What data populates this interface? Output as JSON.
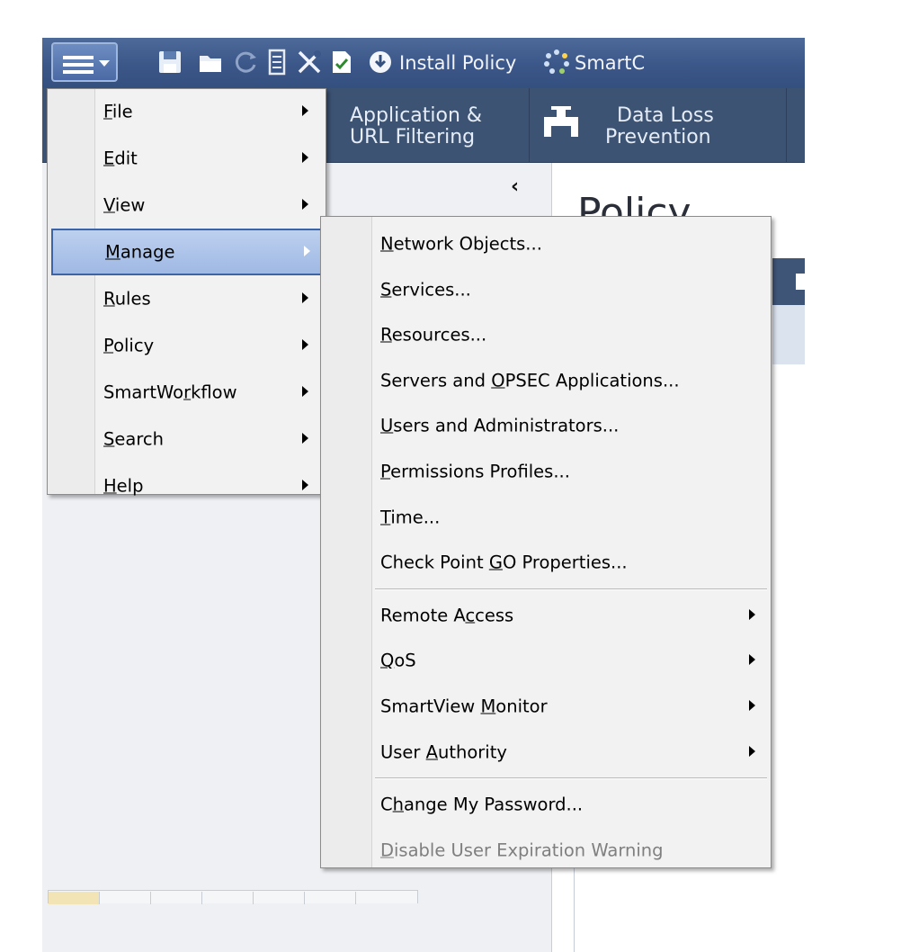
{
  "toolbar": {
    "install_policy_label": "Install Policy",
    "smartc_label": "SmartC",
    "icons": [
      "app-menu-icon",
      "save-icon",
      "open-folder-icon",
      "refresh-icon",
      "server-icon",
      "tools-icon",
      "verify-icon",
      "install-policy-icon",
      "smartconsole-icon"
    ]
  },
  "ribbon": {
    "tabs": [
      {
        "line1": "Application &",
        "line2": "URL Filtering"
      },
      {
        "line1": "Data Loss",
        "line2": "Prevention",
        "icon": "faucet-icon"
      }
    ]
  },
  "content": {
    "title": "Policy"
  },
  "left_panel": {
    "collapse_glyph": "‹"
  },
  "main_menu": {
    "items": [
      {
        "label": "File",
        "underline": 0
      },
      {
        "label": "Edit",
        "underline": 0
      },
      {
        "label": "View",
        "underline": 0
      },
      {
        "label": "Manage",
        "underline": 0,
        "selected": true
      },
      {
        "label": "Rules",
        "underline": 0
      },
      {
        "label": "Policy",
        "underline": 0
      },
      {
        "label": "SmartWorkflow",
        "underline": 7
      },
      {
        "label": "Search",
        "underline": 0
      },
      {
        "label": "Help",
        "underline": 0
      }
    ]
  },
  "manage_submenu": {
    "groups": [
      [
        {
          "label": "Network Objects...",
          "underline": 0
        },
        {
          "label": "Services...",
          "underline": 0
        },
        {
          "label": "Resources...",
          "underline": 0
        },
        {
          "label": "Servers and OPSEC Applications...",
          "underline": 12
        },
        {
          "label": "Users and Administrators...",
          "underline": 0
        },
        {
          "label": "Permissions Profiles...",
          "underline": 0
        },
        {
          "label": "Time...",
          "underline": 0
        },
        {
          "label": "Check Point GO Properties...",
          "underline": 12
        }
      ],
      [
        {
          "label": "Remote Access",
          "underline": 8,
          "submenu": true
        },
        {
          "label": "QoS",
          "underline": 0,
          "submenu": true
        },
        {
          "label": "SmartView Monitor",
          "underline": 10,
          "submenu": true
        },
        {
          "label": "User Authority",
          "underline": 5,
          "submenu": true
        }
      ],
      [
        {
          "label": "Change My Password...",
          "underline": 1
        },
        {
          "label": "Disable User Expiration Warning",
          "underline": 0,
          "disabled": true
        }
      ]
    ]
  }
}
